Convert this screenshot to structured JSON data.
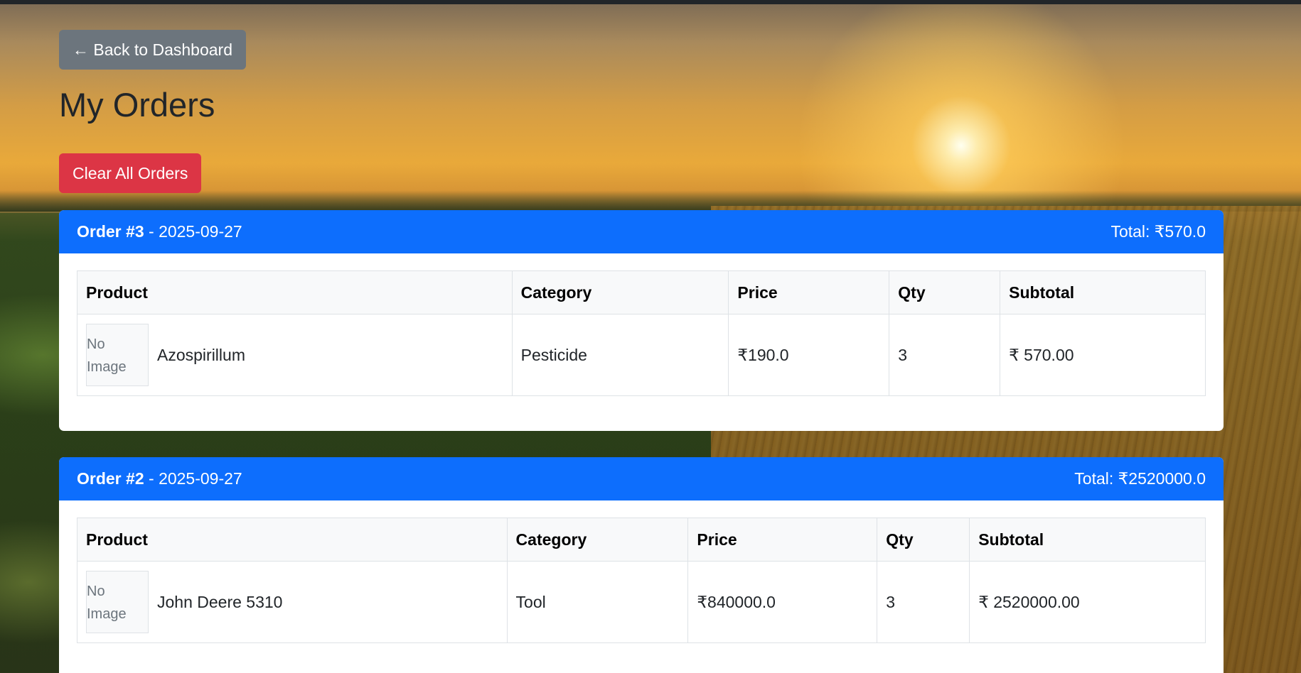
{
  "nav": {
    "back_label": "← Back to Dashboard"
  },
  "page": {
    "title": "My Orders"
  },
  "actions": {
    "clear_label": "Clear All Orders"
  },
  "table_headers": [
    "Product",
    "Category",
    "Price",
    "Qty",
    "Subtotal"
  ],
  "no_image_text": "No Image",
  "orders": [
    {
      "number": "Order #3",
      "date": "2025-09-27",
      "total": "Total: ₹570.0",
      "items": [
        {
          "product": "Azospirillum",
          "category": "Pesticide",
          "price": "₹190.0",
          "qty": "3",
          "subtotal": "₹ 570.00"
        }
      ]
    },
    {
      "number": "Order #2",
      "date": "2025-09-27",
      "total": "Total: ₹2520000.0",
      "items": [
        {
          "product": "John Deere 5310",
          "category": "Tool",
          "price": "₹840000.0",
          "qty": "3",
          "subtotal": "₹ 2520000.00"
        }
      ]
    }
  ],
  "colors": {
    "primary": "#0d6efd",
    "danger": "#dc3545",
    "secondary": "#6c757d"
  }
}
